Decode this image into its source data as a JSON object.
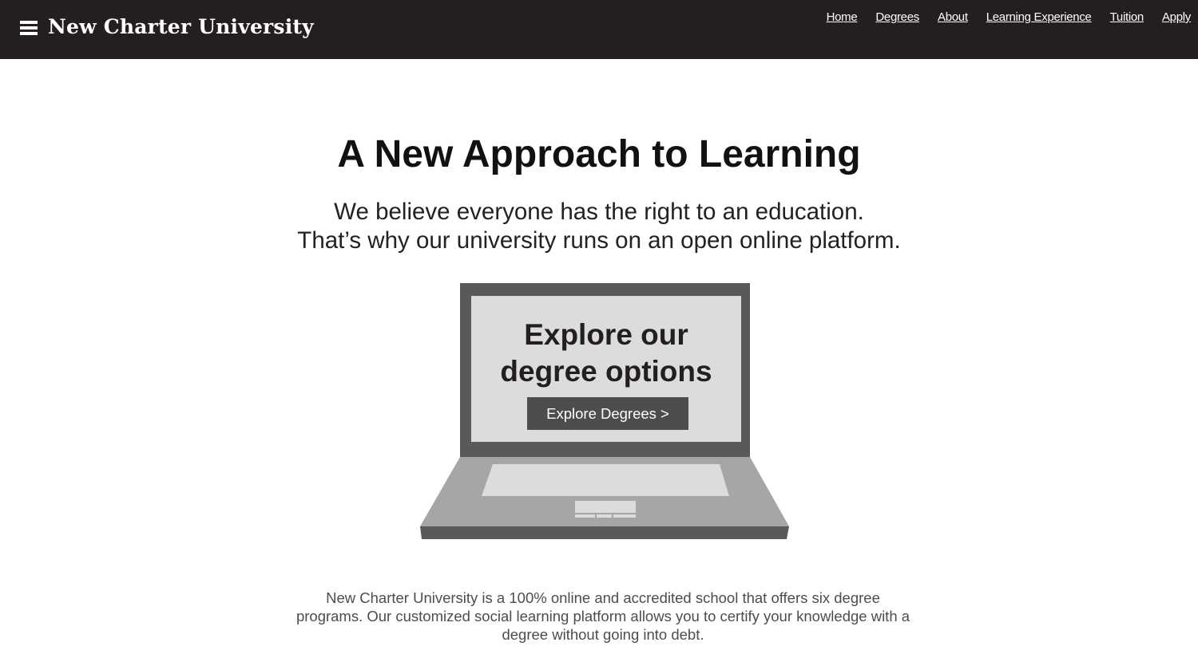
{
  "header": {
    "brand": "New Charter University",
    "menu_icon": "hamburger-menu-icon",
    "nav": [
      {
        "label": "Home"
      },
      {
        "label": "Degrees"
      },
      {
        "label": "About"
      },
      {
        "label": "Learning Experience"
      },
      {
        "label": "Tuition"
      },
      {
        "label": "Apply"
      }
    ]
  },
  "hero": {
    "title": "A New Approach to Learning",
    "subtitle_line1": "We believe everyone has the right to an education.",
    "subtitle_line2": "That’s why our university runs on an open online platform."
  },
  "laptop": {
    "screen_title_line1": "Explore our",
    "screen_title_line2": "degree options",
    "button_label": "Explore Degrees >"
  },
  "description": "New Charter University is a 100% online and accredited school that offers six degree programs. Our customized social learning platform allows you to certify your knowledge with a degree without going into debt.",
  "colors": {
    "header_bg": "#231f20",
    "screen_frame": "#595959",
    "screen_bg": "#dcdcdd",
    "button_bg": "#4d4d4d",
    "base_top": "#a6a6a6",
    "base_edge": "#595959"
  }
}
